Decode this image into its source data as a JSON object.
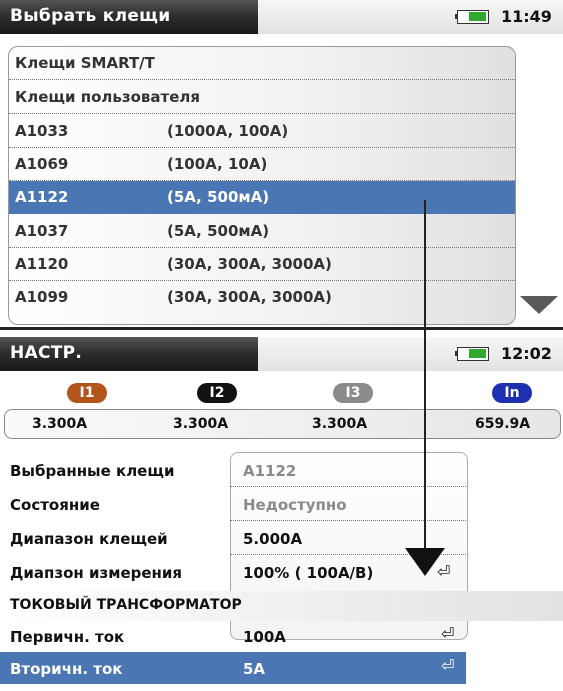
{
  "top_screen": {
    "title": "Выбрать клещи",
    "time": "11:49",
    "items": [
      {
        "name": "Клещи SMART/T",
        "range": ""
      },
      {
        "name": "Клещи пользователя",
        "range": ""
      },
      {
        "name": "A1033",
        "range": "(1000A, 100A)"
      },
      {
        "name": "A1069",
        "range": "(100A, 10A)"
      },
      {
        "name": "A1122",
        "range": "(5A, 500мA)"
      },
      {
        "name": "A1037",
        "range": "(5A, 500мA)"
      },
      {
        "name": "A1120",
        "range": "(30A, 300A, 3000A)"
      },
      {
        "name": "A1099",
        "range": "(30A, 300A, 3000A)"
      }
    ],
    "selected_index": 4,
    "scroll_icon": "triangle-down-icon"
  },
  "bottom_screen": {
    "title": "НАСТР.",
    "time": "12:02",
    "channels": [
      {
        "label": "I1",
        "value": "3.300A",
        "color": "#b3541a"
      },
      {
        "label": "I2",
        "value": "3.300A",
        "color": "#111111"
      },
      {
        "label": "I3",
        "value": "3.300A",
        "color": "#8a8a8a"
      },
      {
        "label": "In",
        "value": "659.9A",
        "color": "#1e2fb0"
      }
    ],
    "settings": {
      "selected_clamp_label": "Выбранные клещи",
      "selected_clamp_value": "A1122",
      "state_label": "Состояние",
      "state_value": "Недоступно",
      "clamp_range_label": "Диапазон клещей",
      "clamp_range_value": "5.000A",
      "meas_range_label": "Диапзон измерения",
      "meas_range_value": "100% ( 100A/В)"
    },
    "ct_section": {
      "header": "ТОКОВЫЙ ТРАНСФОРМАТОР",
      "primary_label": "Первичн. ток",
      "primary_value": "100A",
      "secondary_label": "Вторичн. ток",
      "secondary_value": "5A"
    },
    "enter_glyph": "⏎",
    "colors": {
      "selection": "#4a77b4",
      "battery": "#2ea82e"
    }
  }
}
